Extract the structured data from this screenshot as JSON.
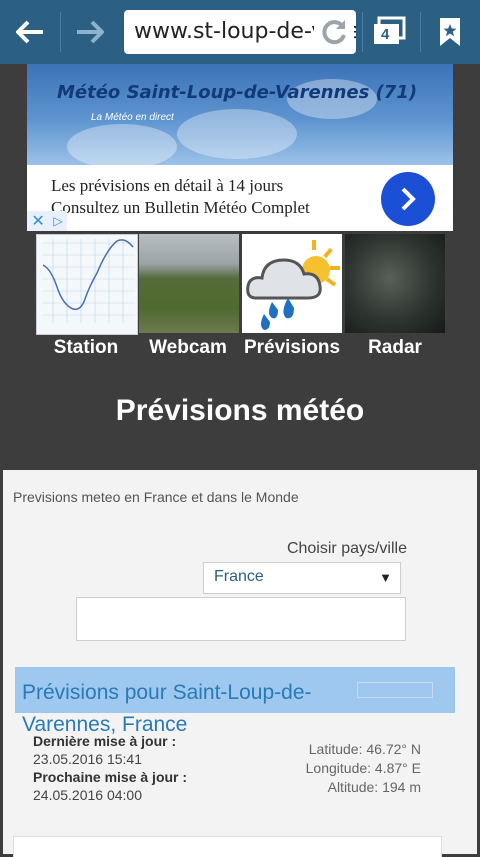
{
  "browser": {
    "url": "www.st-loup-de-varennes",
    "tab_count": "4"
  },
  "banner": {
    "title": "Météo Saint-Loup-de-Varennes (71)",
    "subtitle": "La Météo en direct"
  },
  "ad": {
    "line1": "Les prévisions en détail à 14 jours",
    "line2": "Consultez un Bulletin Météo Complet"
  },
  "nav": {
    "items": [
      {
        "label": "Station"
      },
      {
        "label": "Webcam"
      },
      {
        "label": "Prévisions"
      },
      {
        "label": "Radar"
      }
    ]
  },
  "section": {
    "title": "Prévisions météo"
  },
  "panel": {
    "intro": "Previsions meteo en France et dans le Monde",
    "choose_label": "Choisir pays/ville",
    "country": "France",
    "city_value": ""
  },
  "forecast": {
    "title": "Prévisions pour Saint-Loup-de-Varennes, France",
    "last_update_label": "Dernière mise à jour :",
    "last_update": "23.05.2016 15:41",
    "next_update_label": "Prochaine mise à jour :",
    "next_update": "24.05.2016 04:00",
    "latitude": "Latitude: 46.72° N",
    "longitude": "Longitude: 4.87° E",
    "altitude": "Altitude: 194 m"
  },
  "colors": {
    "toolbar": "#2b5f84",
    "page_bg": "#3d3d3d",
    "accent": "#2a7ab8"
  }
}
